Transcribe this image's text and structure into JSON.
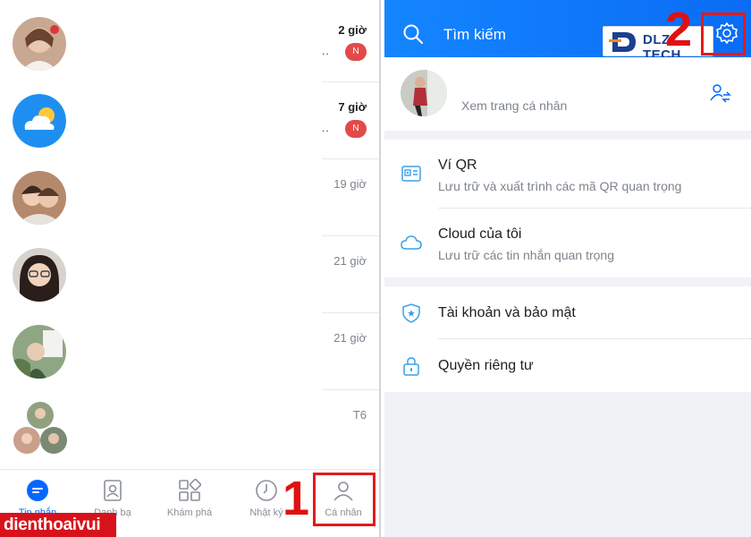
{
  "left_panel": {
    "chats": [
      {
        "time": "2 giờ",
        "unread": true,
        "preview_dots": "..",
        "badge": "N"
      },
      {
        "time": "7 giờ",
        "unread": true,
        "preview_dots": "..",
        "badge": "N"
      },
      {
        "time": "19 giờ",
        "unread": false
      },
      {
        "time": "21 giờ",
        "unread": false
      },
      {
        "time": "21 giờ",
        "unread": false
      },
      {
        "time": "T6",
        "unread": false
      }
    ],
    "bottom_nav": [
      {
        "label": "Tin nhắn",
        "icon": "chat-bubble-icon",
        "active": true
      },
      {
        "label": "Danh bạ",
        "icon": "contacts-icon",
        "active": false
      },
      {
        "label": "Khám phá",
        "icon": "grid-icon",
        "active": false
      },
      {
        "label": "Nhật ký",
        "icon": "clock-icon",
        "active": false
      },
      {
        "label": "Cá nhân",
        "icon": "person-icon",
        "active": false
      }
    ],
    "step_label": "1",
    "watermark": "dienthoaivui"
  },
  "right_panel": {
    "search_placeholder": "Tìm kiếm",
    "step_label": "2",
    "logo_text": "DLZ TECH",
    "profile": {
      "link_text": "Xem trang cá nhân"
    },
    "group1": [
      {
        "title": "Ví QR",
        "subtitle": "Lưu trữ và xuất trình các mã QR quan trọng",
        "icon": "qr-wallet-icon"
      },
      {
        "title": "Cloud của tôi",
        "subtitle": "Lưu trữ các tin nhắn quan trọng",
        "icon": "cloud-icon"
      }
    ],
    "group2": [
      {
        "title": "Tài khoản và bảo mật",
        "icon": "shield-icon"
      },
      {
        "title": "Quyền riêng tư",
        "icon": "lock-icon"
      }
    ]
  },
  "colors": {
    "accent": "#0068ff",
    "highlight": "#e21b1b",
    "badge": "#e24a4a"
  }
}
